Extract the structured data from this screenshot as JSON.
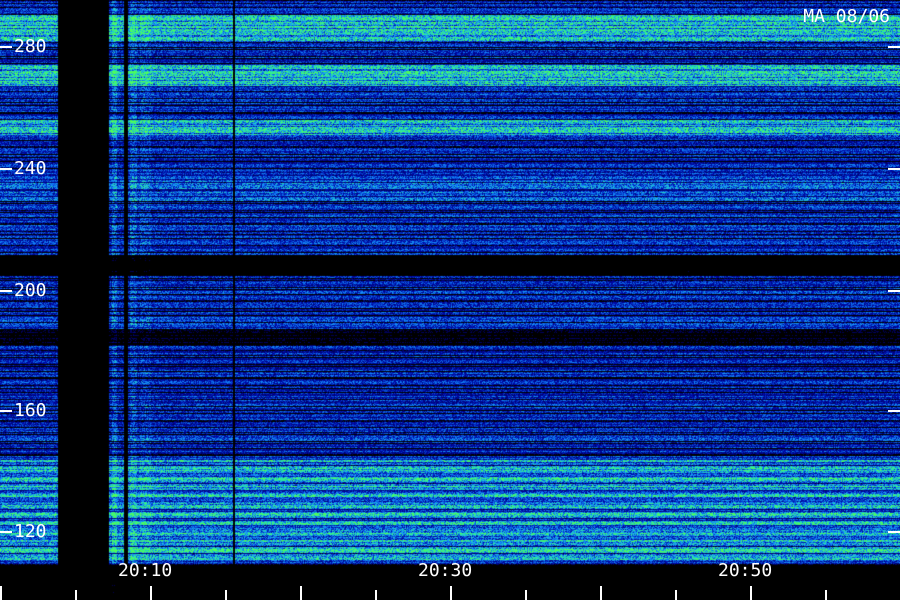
{
  "station_date": "MA 08/06",
  "frequency_axis": {
    "labels": [
      "280",
      "240",
      "200",
      "160",
      "120"
    ],
    "values": [
      280,
      240,
      200,
      160,
      120
    ],
    "range": [
      105,
      295
    ]
  },
  "time_axis": {
    "labels": [
      "20:10",
      "20:30",
      "20:50"
    ],
    "minutes": [
      10,
      30,
      50
    ],
    "range_minutes": [
      0,
      60
    ]
  },
  "colors": {
    "background": "#000000",
    "low": "#0a10a0",
    "mid": "#1060ff",
    "high": "#20e0b0",
    "peak": "#40ff60",
    "text": "#ffffff"
  }
}
